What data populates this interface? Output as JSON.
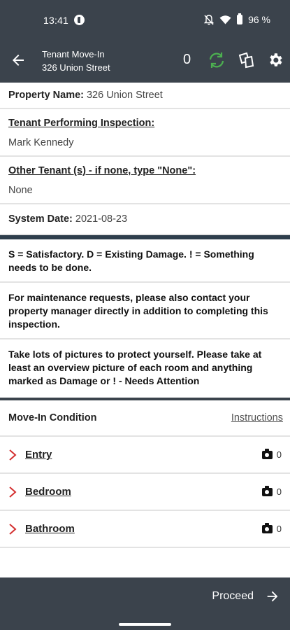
{
  "status_bar": {
    "time": "13:41",
    "battery_text": "96 %"
  },
  "app_bar": {
    "title": "Tenant Move-In",
    "subtitle": "326 Union Street",
    "count": "0",
    "icons": [
      "back-arrow-icon",
      "sync-icon",
      "copy-icon",
      "gear-icon"
    ],
    "sync_color": "#4caf50"
  },
  "fields": {
    "property": {
      "label": "Property Name:",
      "value": "326 Union Street"
    },
    "tenant": {
      "label": "Tenant Performing Inspection:",
      "value": "Mark Kennedy"
    },
    "other_tenants": {
      "label": "Other Tenant (s) - if none, type \"None\":",
      "value": "None"
    },
    "system_date": {
      "label": "System Date:",
      "value": "2021-08-23"
    }
  },
  "notices": [
    "S = Satisfactory.  D = Existing Damage.  ! = Something needs to be done.",
    "For maintenance requests, please also contact your property manager directly in addition to completing this inspection.",
    "Take lots of pictures to protect yourself.  Please take at least an overview picture of each room and anything marked as Damage or ! - Needs Attention"
  ],
  "section": {
    "title": "Move-In Condition",
    "instructions_label": "Instructions"
  },
  "rooms": [
    {
      "name": "Entry",
      "photos": "0"
    },
    {
      "name": "Bedroom",
      "photos": "0"
    },
    {
      "name": "Bathroom",
      "photos": "0"
    }
  ],
  "bottom_bar": {
    "proceed_label": "Proceed"
  },
  "colors": {
    "bar_bg": "#3b434c",
    "chevron": "#d32f2f"
  }
}
